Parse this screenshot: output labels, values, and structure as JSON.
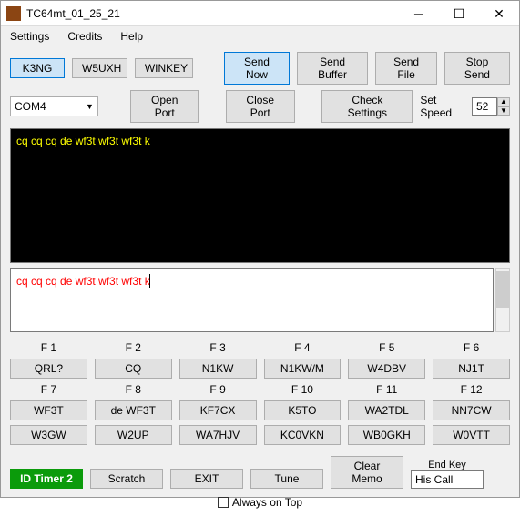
{
  "title": "TC64mt_01_25_21",
  "menu": [
    "Settings",
    "Credits",
    "Help"
  ],
  "mode_buttons": [
    "K3NG",
    "W5UXH",
    "WINKEY"
  ],
  "active_mode": 0,
  "send_buttons": [
    "Send Now",
    "Send Buffer",
    "Send File",
    "Stop Send"
  ],
  "highlight_send": 0,
  "port_combo": "COM4",
  "port_buttons": [
    "Open Port",
    "Close Port",
    "Check Settings"
  ],
  "speed_label": "Set Speed",
  "speed_value": "52",
  "tx_text": "cq cq cq de wf3t wf3t wf3t k",
  "input_text": "cq cq cq de wf3t wf3t wf3t k",
  "fkey_labels": [
    "F 1",
    "F 2",
    "F 3",
    "F 4",
    "F 5",
    "F 6",
    "F 7",
    "F 8",
    "F 9",
    "F 10",
    "F 11",
    "F 12"
  ],
  "fkey_vals": [
    "QRL?",
    "CQ",
    "N1KW",
    "N1KW/M",
    "W4DBV",
    "NJ1T",
    "WF3T",
    "de WF3T",
    "KF7CX",
    "K5TO",
    "WA2TDL",
    "NN7CW",
    "W3GW",
    "W2UP",
    "WA7HJV",
    "KC0VKN",
    "WB0GKH",
    "W0VTT"
  ],
  "id_timer": "ID Timer 2",
  "bottom_buttons": [
    "Scratch",
    "EXIT",
    "Tune",
    "Clear Memo"
  ],
  "end_key_label": "End Key",
  "end_key_value": "His Call",
  "always_on_top": "Always on Top"
}
